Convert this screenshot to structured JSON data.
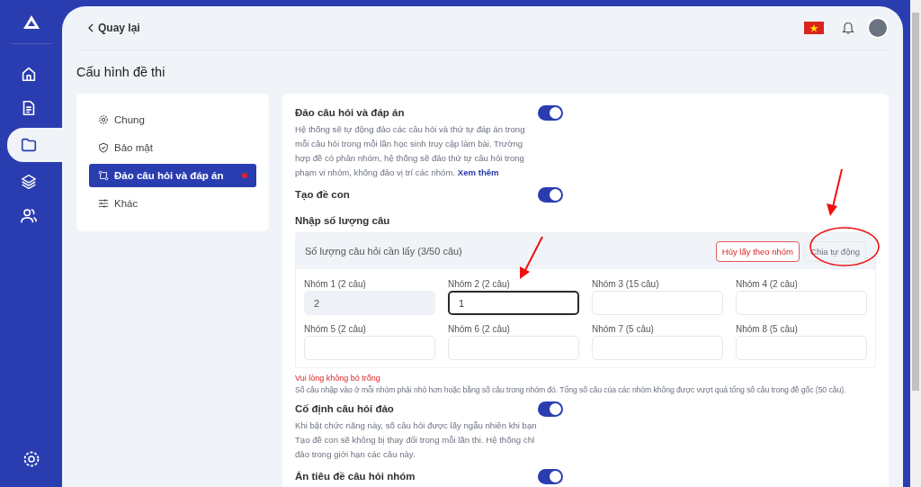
{
  "sidebar": {
    "items": [
      {
        "selected": false
      },
      {
        "selected": false
      },
      {
        "selected": true
      },
      {
        "selected": false
      },
      {
        "selected": false
      }
    ]
  },
  "header": {
    "back_link": "Quay lại"
  },
  "page_title": "Cấu hình đề thi",
  "settings_nav": {
    "items": [
      {
        "label": "Chung",
        "selected": false,
        "dot": false
      },
      {
        "label": "Bảo mật",
        "selected": false,
        "dot": false
      },
      {
        "label": "Đảo câu hỏi và đáp án",
        "selected": true,
        "dot": true
      },
      {
        "label": "Khác",
        "selected": false,
        "dot": false
      }
    ]
  },
  "options": [
    {
      "kind": "toggle",
      "title": "Đảo câu hỏi và đáp án",
      "on": true,
      "description": "Hệ thống sẽ tự động đảo các câu hỏi và thứ tự đáp án trong mỗi câu hỏi trong mỗi lần học sinh truy cập làm bài. Trường hợp đề có phân nhóm, hệ thống sẽ đảo thứ tự câu hỏi trong phạm vi nhóm, không đảo vị trí các nhóm.",
      "link": "Xem thêm"
    },
    {
      "kind": "toggle",
      "title": "Tạo đề con",
      "on": true
    },
    {
      "kind": "quantity",
      "title": "Nhập số lượng câu",
      "summary": "Số lượng câu hỏi cần lấy (3/50 câu)",
      "buttons": [
        {
          "label": "Hủy lấy theo nhóm",
          "kind": "danger"
        },
        {
          "label": "Chia tự động",
          "kind": "plain"
        }
      ],
      "groups": [
        {
          "label": "Nhóm 1 (2 câu)",
          "value": "2",
          "disabled": true,
          "focused": false
        },
        {
          "label": "Nhóm 2 (2 câu)",
          "value": "1",
          "disabled": false,
          "focused": true
        },
        {
          "label": "Nhóm 3 (15 câu)",
          "disabled": false,
          "focused": false
        },
        {
          "label": "Nhóm 4 (2 câu)",
          "disabled": false,
          "focused": false
        },
        {
          "label": "Nhóm 5 (2 câu)",
          "disabled": false,
          "focused": false
        },
        {
          "label": "Nhóm 6 (2 câu)",
          "disabled": false,
          "focused": false
        },
        {
          "label": "Nhóm 7 (5 câu)",
          "disabled": false,
          "focused": false
        },
        {
          "label": "Nhóm 8 (5 câu)",
          "disabled": false,
          "focused": false
        }
      ],
      "error": "Vui lòng không bỏ trống",
      "hint": "Số câu nhập vào ở mỗi nhóm phải nhỏ hơn hoặc bằng số câu trong nhóm đó. Tổng số câu của các nhóm không được vượt quá tổng số câu trong đề gốc (50 câu)."
    },
    {
      "kind": "toggle",
      "title": "Cố định câu hỏi đảo",
      "on": true,
      "description": "Khi bật chức năng này, số câu hỏi được lấy ngẫu nhiên khi bạn Tạo đề con sẽ không bị thay đổi trong mỗi lần thi. Hệ thống chỉ đảo trong giới hạn các câu này."
    },
    {
      "kind": "toggle",
      "title": "Ẩn tiêu đề câu hỏi nhóm",
      "on": true
    }
  ]
}
